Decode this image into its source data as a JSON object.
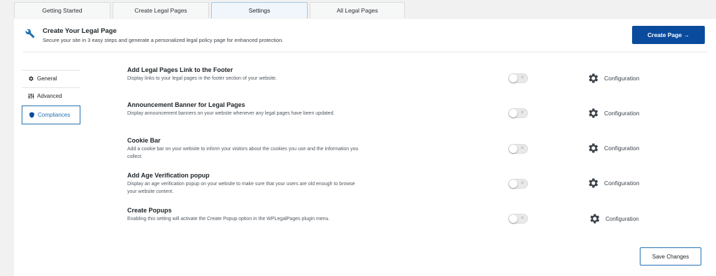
{
  "tabs": [
    {
      "label": "Getting Started"
    },
    {
      "label": "Create Legal Pages"
    },
    {
      "label": "Settings"
    },
    {
      "label": "All Legal Pages"
    }
  ],
  "active_tab": "Settings",
  "header": {
    "icon": "wrench-icon",
    "title": "Create Your Legal Page",
    "subtitle": "Secure your site in 3 easy steps and generate a personalized legal policy page for enhanced protection.",
    "create_button": "Create Page →"
  },
  "sidebar": {
    "items": [
      {
        "label": "General",
        "icon": "gear-icon"
      },
      {
        "label": "Advanced",
        "icon": "sliders-icon"
      },
      {
        "label": "Compliances",
        "icon": "shield-icon"
      }
    ],
    "active": "Compliances"
  },
  "settings": [
    {
      "title": "Add Legal Pages Link to the Footer",
      "description": "Display links to your legal pages in the footer section of your website.",
      "enabled": false,
      "config_label": "Configuration"
    },
    {
      "title": "Announcement Banner for Legal Pages",
      "description": "Display announcement banners on your website whenever any legal pages have been updated.",
      "enabled": false,
      "config_label": "Configuration"
    },
    {
      "title": "Cookie Bar",
      "description": "Add a cookie bar on your website to inform your visitors about the cookies you use and the information you collect.",
      "enabled": false,
      "config_label": "Configuration"
    },
    {
      "title": "Add Age Verification popup",
      "description": "Display an age verification popup on your website to make sure that your users are old enough to browse your website content.",
      "enabled": false,
      "config_label": "Configuration"
    },
    {
      "title": "Create Popups",
      "description": "Enabling this setting will activate the Create Popup option in the WPLegalPages plugin menu.",
      "enabled": false,
      "config_label": "Configuration"
    }
  ],
  "toggle_off_mark": "✕",
  "save_button": "Save Changes",
  "colors": {
    "primary": "#0a4b9e",
    "accent": "#2271b1",
    "background": "#f1f1f1"
  }
}
